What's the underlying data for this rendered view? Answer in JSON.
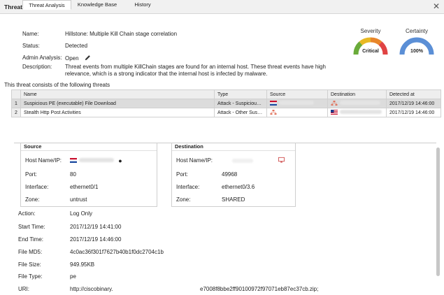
{
  "window": {
    "title": "Threat"
  },
  "summary": {
    "name_label": "Name:",
    "name": "Hillstone: Multiple Kill Chain stage correlation",
    "status_label": "Status:",
    "status": "Detected",
    "analysis_label": "Admin Analysis:",
    "analysis": "Open",
    "description_label": "Description:",
    "description": "Threat events from multiple KillChain stages are found for an internal host. These threat events have high relevance, which is a strong indicator that the internal host is infected by malware."
  },
  "severity": {
    "label": "Severity",
    "value": "Critical"
  },
  "certainty": {
    "label": "Certainty",
    "value": "100%",
    "level": 1.0
  },
  "consists_text": "This threat consists of the following threats",
  "table": {
    "headers": [
      "Name",
      "Type",
      "Source",
      "Destination",
      "Detected at"
    ],
    "rows": [
      {
        "num": "1",
        "name": "Suspicious PE (executable) File Download",
        "type": "Attack - Suspicious ...",
        "detected": "2017/12/19 14:46:00"
      },
      {
        "num": "2",
        "name": "Stealth Http Post Activities",
        "type": "Attack - Other Susp...",
        "detected": "2017/12/19 14:46:00"
      }
    ]
  },
  "tabs": [
    "Threat Analysis",
    "Knowledge Base",
    "History"
  ],
  "source": {
    "title": "Source",
    "host_label": "Host Name/IP:",
    "port_label": "Port:",
    "port": "80",
    "iface_label": "Interface:",
    "iface": "ethernet0/1",
    "zone_label": "Zone:",
    "zone": "untrust"
  },
  "destination": {
    "title": "Destination",
    "host_label": "Host Name/IP:",
    "port_label": "Port:",
    "port": "49968",
    "iface_label": "Interface:",
    "iface": "ethernet0/3.6",
    "zone_label": "Zone:",
    "zone": "SHARED"
  },
  "details": {
    "action_label": "Action:",
    "action": "Log Only",
    "start_label": "Start Time:",
    "start": "2017/12/19 14:41:00",
    "end_label": "End Time:",
    "end": "2017/12/19 14:46:00",
    "md5_label": "File MD5:",
    "md5": "4c0ac36f301f7627b40b1f0dc2704c1b",
    "size_label": "File Size:",
    "size": "949.95KB",
    "type_label": "File Type:",
    "type": "pe",
    "uri_label": "URI:",
    "uri": "http://ciscobinary.",
    "uri_tail": "e7008f8bbe2ff90100972f97071eb87ec37cb.zip;"
  },
  "colors": {
    "gauge_blue": "#5b8fd6",
    "gauge_red": "#e04343",
    "gauge_green": "#6aab3a",
    "gauge_yellow": "#e8b923"
  }
}
